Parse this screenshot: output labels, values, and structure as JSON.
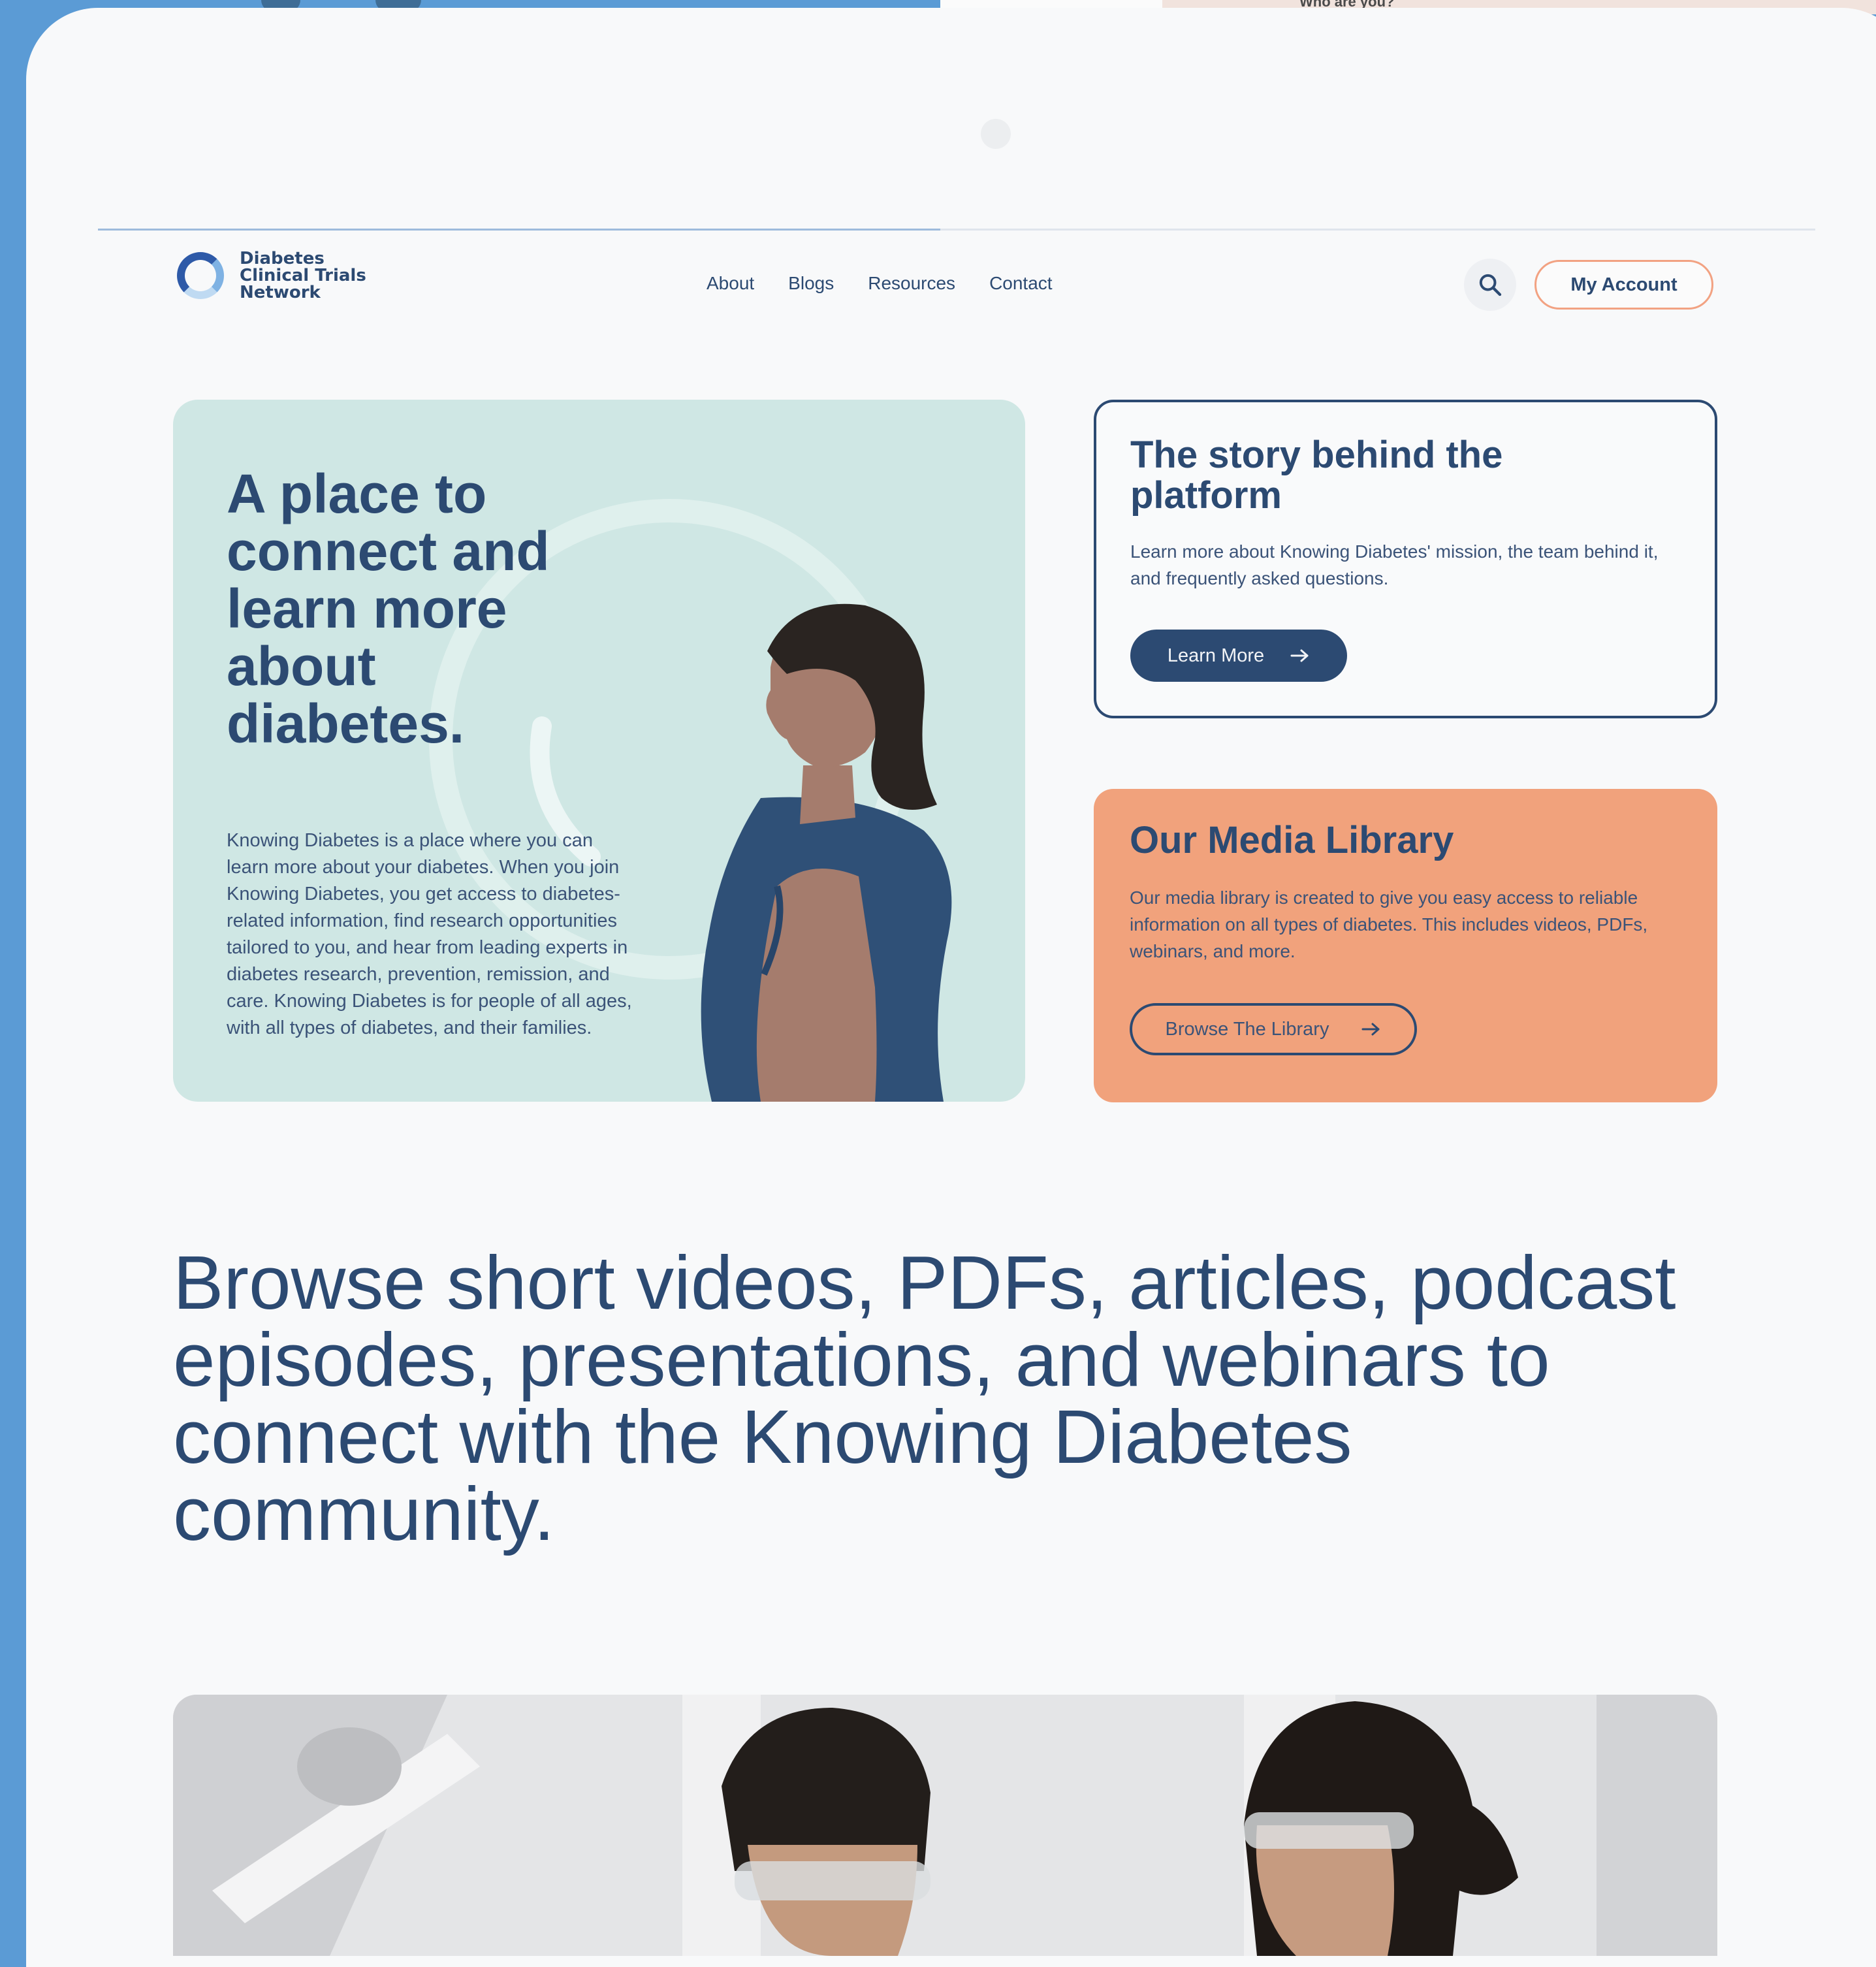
{
  "background_sheet": {
    "text": "Who are you?"
  },
  "brand": {
    "line1": "Diabetes",
    "line2": "Clinical Trials",
    "line3": "Network"
  },
  "nav": {
    "items": [
      "About",
      "Blogs",
      "Resources",
      "Contact"
    ]
  },
  "header": {
    "account_label": "My Account"
  },
  "hero": {
    "title": "A place to connect and learn more about diabetes.",
    "body": "Knowing Diabetes is a place where you can learn more about your diabetes. When you join Knowing Diabetes, you get access to diabetes-related information, find research opportunities tailored to you, and hear from leading experts in diabetes research, prevention, remission, and care. Knowing Diabetes is for people of all ages, with all types of diabetes, and their families."
  },
  "story": {
    "title": "The story behind the platform",
    "body": "Learn more about Knowing Diabetes' mission, the team behind it, and frequently asked questions.",
    "button_label": "Learn More"
  },
  "media": {
    "title": "Our Media Library",
    "body": "Our media library is created to give you easy access to reliable information on all types of diabetes. This includes videos, PDFs, webinars, and more.",
    "button_label": "Browse The Library"
  },
  "headline": "Browse short videos, PDFs, articles, podcast episodes, presentations, and webinars to connect with the Knowing Diabetes community.",
  "icons": {
    "search": "search-icon",
    "arrow": "arrow-right-icon"
  },
  "colors": {
    "navy": "#2c4a72",
    "mint": "#cfe7e4",
    "peach": "#f1a27c",
    "frame_blue": "#5b9bd5"
  }
}
